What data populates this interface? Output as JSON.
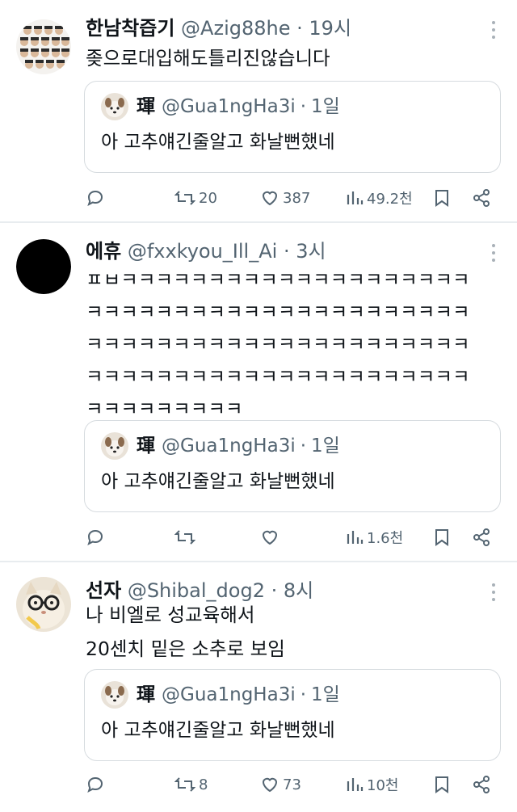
{
  "tweets": [
    {
      "name": "한남착즙기",
      "handle": "@Azig88he",
      "time": "19시",
      "text_lines": [
        "좆으로대입해도틀리진않습니다"
      ],
      "quote": {
        "name": "琿",
        "handle": "@Gua1ngHa3i",
        "time": "1일",
        "text": "아 고추얘긴줄알고 화날뻔했네"
      },
      "stats": {
        "replies": "",
        "retweets": "20",
        "likes": "387",
        "views": "49.2천"
      },
      "avatar_icon": "group-photo-avatar"
    },
    {
      "name": "에휴",
      "handle": "@fxxkyou_Ill_Ai",
      "time": "3시",
      "text_lines": [
        "ㅍㅂㅋㅋㅋㅋㅋㅋㅋㅋㅋㅋㅋㅋㅋㅋㅋㅋㅋㅋㅋㅋ",
        "ㅋㅋㅋㅋㅋㅋㅋㅋㅋㅋㅋㅋㅋㅋㅋㅋㅋㅋㅋㅋㅋㅋ",
        "ㅋㅋㅋㅋㅋㅋㅋㅋㅋㅋㅋㅋㅋㅋㅋㅋㅋㅋㅋㅋㅋㅋ",
        "ㅋㅋㅋㅋㅋㅋㅋㅋㅋㅋㅋㅋㅋㅋㅋㅋㅋㅋㅋㅋㅋㅋ",
        "ㅋㅋㅋㅋㅋㅋㅋㅋㅋ"
      ],
      "quote": {
        "name": "琿",
        "handle": "@Gua1ngHa3i",
        "time": "1일",
        "text": "아 고추얘긴줄알고 화날뻔했네"
      },
      "stats": {
        "replies": "",
        "retweets": "",
        "likes": "",
        "views": "1.6천"
      },
      "avatar_icon": "black-circle-avatar"
    },
    {
      "name": "선자",
      "handle": "@Shibal_dog2",
      "time": "8시",
      "text_lines": [
        "나 비엘로 성교육해서",
        "20센치 밑은 소추로 보임"
      ],
      "quote": {
        "name": "琿",
        "handle": "@Gua1ngHa3i",
        "time": "1일",
        "text": "아 고추얘긴줄알고 화날뻔했네"
      },
      "stats": {
        "replies": "",
        "retweets": "8",
        "likes": "73",
        "views": "10천"
      },
      "avatar_icon": "cat-with-glasses-avatar"
    }
  ],
  "separator": "·",
  "colors": {
    "text": "#0f1419",
    "secondary": "#536471",
    "border": "#d6dbdf",
    "divider": "#e8ecef"
  }
}
